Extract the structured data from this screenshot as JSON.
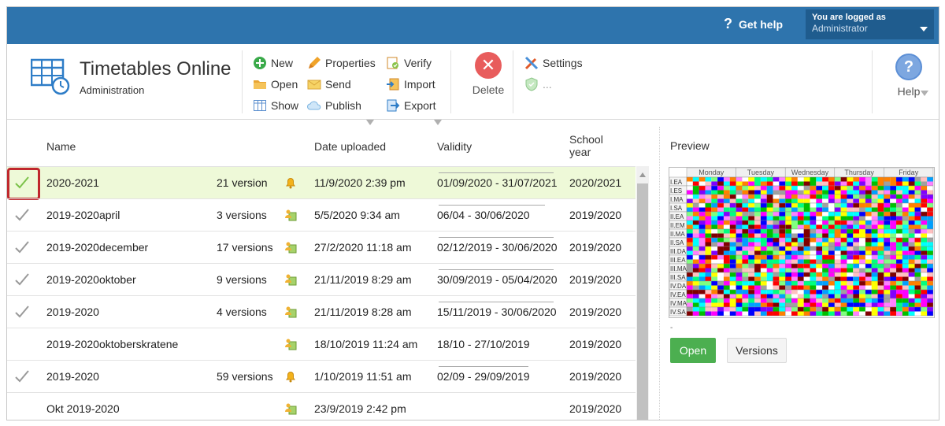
{
  "topbar": {
    "help_label": "Get help",
    "login_line1": "You are logged as",
    "login_user": "Administrator"
  },
  "app": {
    "title": "Timetables Online",
    "subtitle": "Administration"
  },
  "toolbar": {
    "new": "New",
    "open": "Open",
    "show": "Show",
    "properties": "Properties",
    "send": "Send",
    "publish": "Publish",
    "verify": "Verify",
    "import": "Import",
    "export": "Export",
    "delete": "Delete",
    "settings": "Settings",
    "ellipsis": "...",
    "help": "Help"
  },
  "table": {
    "headers": {
      "name": "Name",
      "date_uploaded": "Date uploaded",
      "validity": "Validity",
      "school_year_1": "School",
      "school_year_2": "year"
    },
    "rows": [
      {
        "name": "2020-2021",
        "versions": "21 version",
        "uploaded": "11/9/2020 2:39 pm",
        "validity": "01/09/2020 - 31/07/2021",
        "year": "2020/2021",
        "checked": true,
        "selected": true,
        "icon": "bell-icon"
      },
      {
        "name": "2019-2020april",
        "versions": "3 versions",
        "uploaded": "5/5/2020 9:34 am",
        "validity": "06/04 - 30/06/2020",
        "year": "2019/2020",
        "checked": true,
        "selected": false,
        "icon": "user-file-icon"
      },
      {
        "name": "2019-2020december",
        "versions": "17 versions",
        "uploaded": "27/2/2020 11:18 am",
        "validity": "02/12/2019 - 30/06/2020",
        "year": "2019/2020",
        "checked": true,
        "selected": false,
        "icon": "user-file-icon"
      },
      {
        "name": "2019-2020oktober",
        "versions": "9 versions",
        "uploaded": "21/11/2019 8:29 am",
        "validity": "30/09/2019 - 05/04/2020",
        "year": "2019/2020",
        "checked": true,
        "selected": false,
        "icon": "user-file-icon"
      },
      {
        "name": "2019-2020",
        "versions": "4 versions",
        "uploaded": "21/11/2019 8:28 am",
        "validity": "15/11/2019 - 30/06/2020",
        "year": "2019/2020",
        "checked": true,
        "selected": false,
        "icon": "user-file-icon"
      },
      {
        "name": "2019-2020oktoberskratene",
        "versions": "",
        "uploaded": "18/10/2019 11:24 am",
        "validity": "18/10 - 27/10/2019",
        "year": "2019/2020",
        "checked": false,
        "selected": false,
        "icon": "user-file-icon"
      },
      {
        "name": "2019-2020",
        "versions": "59 versions",
        "uploaded": "1/10/2019 11:51 am",
        "validity": "02/09 - 29/09/2019",
        "year": "2019/2020",
        "checked": true,
        "selected": false,
        "icon": "bell-icon"
      },
      {
        "name": "Okt 2019-2020",
        "versions": "",
        "uploaded": "23/9/2019 2:42 pm",
        "validity": "",
        "year": "2019/2020",
        "checked": false,
        "selected": false,
        "icon": "user-file-icon"
      }
    ]
  },
  "preview": {
    "title": "Preview",
    "days": [
      "Monday",
      "Tuesday",
      "Wednesday",
      "Thursday",
      "Friday"
    ],
    "classes": [
      "I.EA",
      "I.ES",
      "I.MA",
      "I.SA",
      "II.EA",
      "II.EM",
      "II.MA",
      "II.SA",
      "III.DA",
      "III.EA",
      "III.MA",
      "III.SA",
      "IV.DA",
      "IV.EA",
      "IV.MA",
      "IV.SA"
    ],
    "dot": "-",
    "open_label": "Open",
    "versions_label": "Versions"
  },
  "colors": {
    "topbar": "#2e74ad",
    "selected_row": "#eef9d8",
    "open_button": "#4caf50",
    "delete": "#e85c5c",
    "check": "#7cc24a"
  }
}
